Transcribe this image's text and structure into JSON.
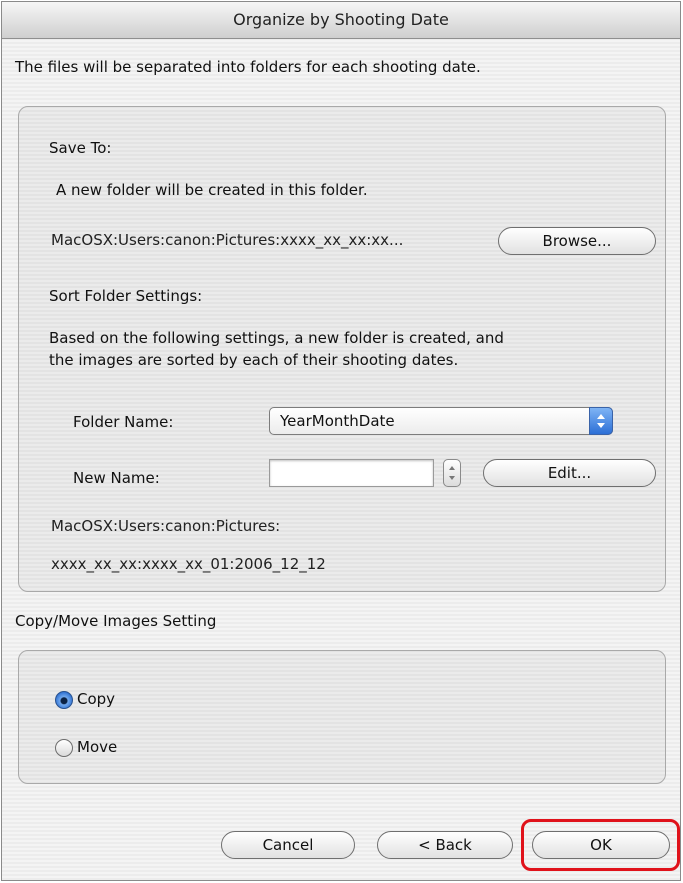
{
  "window": {
    "title": "Organize by Shooting Date"
  },
  "description": "The files will be separated into folders for each shooting date.",
  "save_to": {
    "heading": "Save To:",
    "info": "A new folder will be created in this folder.",
    "path": "MacOSX:Users:canon:Pictures:xxxx_xx_xx:xx...",
    "browse_label": "Browse..."
  },
  "sort_settings": {
    "heading": "Sort Folder Settings:",
    "info_line1": "Based on the following settings, a new folder is created, and",
    "info_line2": "the images are sorted by each of their shooting dates.",
    "folder_name_label": "Folder Name:",
    "folder_name_value": "YearMonthDate",
    "new_name_label": "New Name:",
    "new_name_value": "",
    "edit_label": "Edit...",
    "result_path_line1": "MacOSX:Users:canon:Pictures:",
    "result_path_line2": "xxxx_xx_xx:xxxx_xx_01:2006_12_12"
  },
  "copy_move": {
    "heading": "Copy/Move Images Setting",
    "options": [
      {
        "label": "Copy",
        "selected": true
      },
      {
        "label": "Move",
        "selected": false
      }
    ]
  },
  "buttons": {
    "cancel": "Cancel",
    "back": "< Back",
    "ok": "OK"
  },
  "colors": {
    "highlight": "#e0121b",
    "accent": "#2d6fd0"
  },
  "icons": {
    "updown": "updown-arrows-icon"
  }
}
